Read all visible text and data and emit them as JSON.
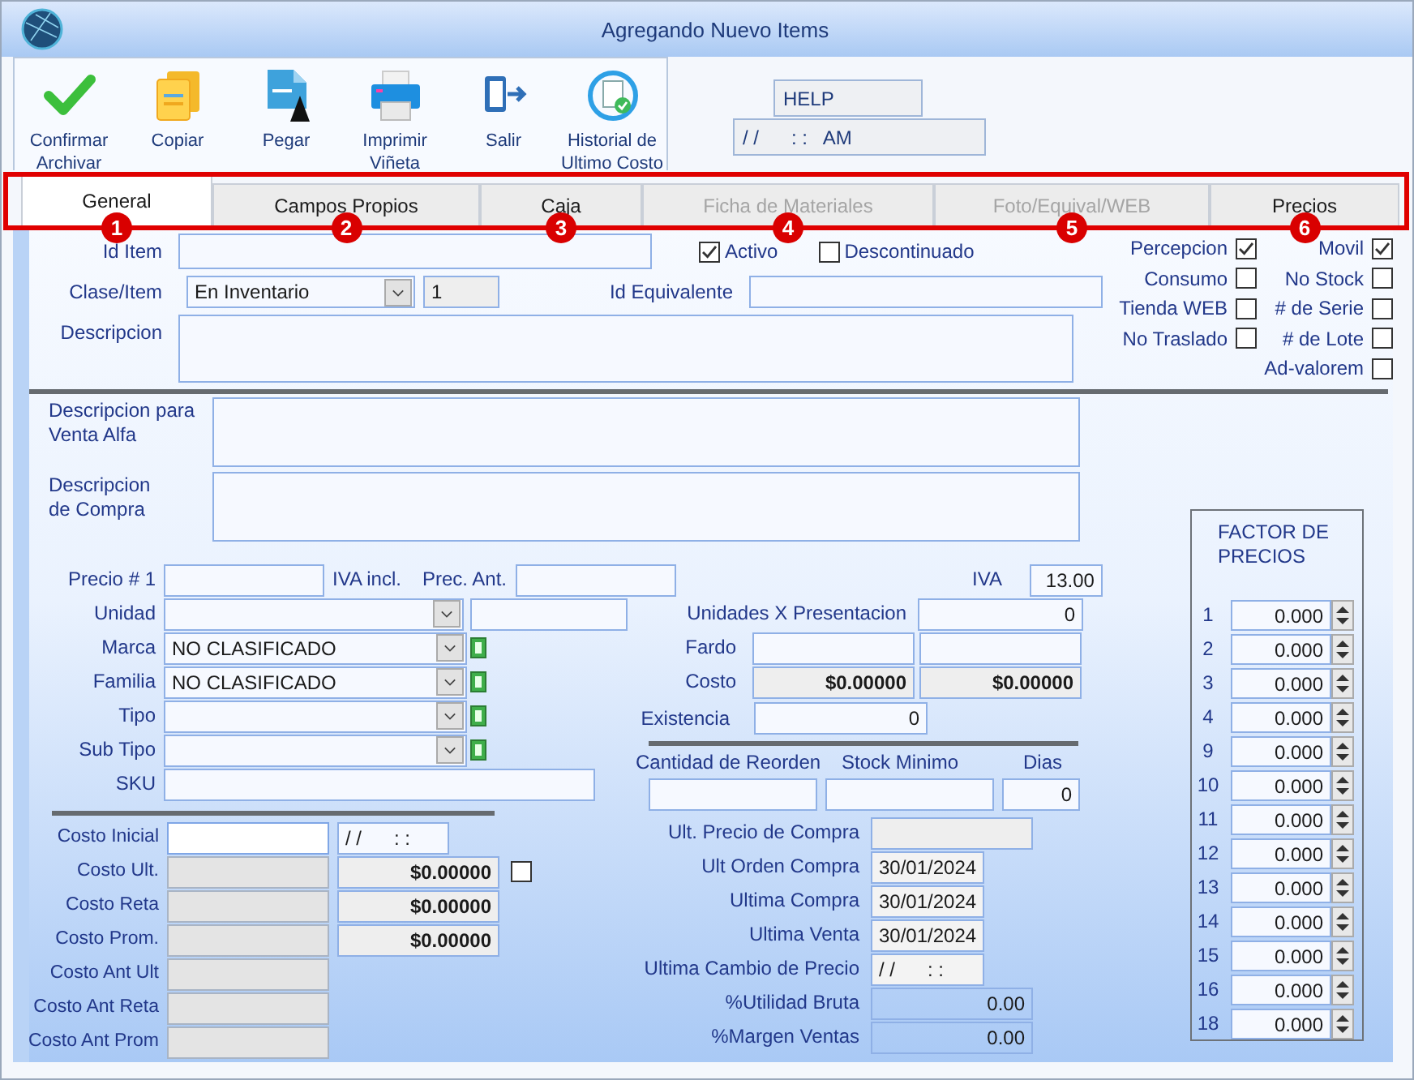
{
  "window": {
    "title": "Agregando Nuevo Items"
  },
  "toolbar": [
    {
      "label": "Confirmar\nArchivar"
    },
    {
      "label": "Copiar"
    },
    {
      "label": "Pegar"
    },
    {
      "label": "Imprimir\nViñeta"
    },
    {
      "label": "Salir"
    },
    {
      "label": "Historial de\nUltimo Costo"
    }
  ],
  "help_field": {
    "value": "HELP"
  },
  "datetime_field": {
    "value": "/ /      : :   AM"
  },
  "tabs": [
    {
      "label": "General",
      "selected": true,
      "disabled": false,
      "marker": "1"
    },
    {
      "label": "Campos Propios",
      "selected": false,
      "disabled": false,
      "marker": "2"
    },
    {
      "label": "Caja",
      "selected": false,
      "disabled": false,
      "marker": "3"
    },
    {
      "label": "Ficha de Materiales",
      "selected": false,
      "disabled": true,
      "marker": "4"
    },
    {
      "label": "Foto/Equival/WEB",
      "selected": false,
      "disabled": true,
      "marker": "5"
    },
    {
      "label": "Precios",
      "selected": false,
      "disabled": false,
      "marker": "6"
    }
  ],
  "item": {
    "id_label": "Id Item",
    "activo": {
      "label": "Activo",
      "checked": true
    },
    "descontinuado": {
      "label": "Descontinuado",
      "checked": false
    },
    "clase_label": "Clase/Item",
    "clase_value": "En Inventario",
    "clase_number": "1",
    "equivalente_label": "Id Equivalente",
    "descripcion_label": "Descripcion"
  },
  "flags_left": [
    {
      "label": "Percepcion",
      "checked": true
    },
    {
      "label": "Consumo",
      "checked": false
    },
    {
      "label": "Tienda WEB",
      "checked": false
    },
    {
      "label": "No Traslado",
      "checked": false
    }
  ],
  "flags_right": [
    {
      "label": "Movil",
      "checked": true
    },
    {
      "label": "No Stock",
      "checked": false
    },
    {
      "label": "# de Serie",
      "checked": false
    },
    {
      "label": "# de Lote",
      "checked": false
    },
    {
      "label": "Ad-valorem",
      "checked": false
    }
  ],
  "descriptions": [
    {
      "label": "Descripcion para\nVenta Alfa"
    },
    {
      "label": "Descripcion\nde Compra"
    }
  ],
  "precio": {
    "label": "Precio # 1",
    "iva_incl": "IVA incl.",
    "prec_ant": "Prec. Ant.",
    "iva_label": "IVA",
    "iva_value": "13.00"
  },
  "classification": [
    {
      "label": "Unidad",
      "kind": "select_extra"
    },
    {
      "label": "Marca",
      "value": "NO CLASIFICADO",
      "kind": "select_add"
    },
    {
      "label": "Familia",
      "value": "NO CLASIFICADO",
      "kind": "select_add"
    },
    {
      "label": "Tipo",
      "kind": "select_add"
    },
    {
      "label": "Sub Tipo",
      "kind": "select_add"
    },
    {
      "label": "SKU",
      "kind": "text"
    }
  ],
  "costs": [
    {
      "label": "Costo Inicial",
      "disabled": false,
      "extra": {
        "kind": "date",
        "value": "/ /      : :"
      }
    },
    {
      "label": "Costo Ult.",
      "disabled": true,
      "extra": {
        "kind": "money",
        "value": "$0.00000"
      },
      "check": {
        "checked": false
      }
    },
    {
      "label": "Costo Reta",
      "disabled": true,
      "extra": {
        "kind": "money",
        "value": "$0.00000"
      }
    },
    {
      "label": "Costo Prom.",
      "disabled": true,
      "extra": {
        "kind": "money",
        "value": "$0.00000"
      }
    },
    {
      "label": "Costo Ant Ult",
      "disabled": true
    },
    {
      "label": "Costo Ant Reta",
      "disabled": true
    },
    {
      "label": "Costo Ant Prom",
      "disabled": true
    }
  ],
  "stock": {
    "unidades_label": "Unidades X Presentacion",
    "unidades_value": "0",
    "fardo_label": "Fardo",
    "costo_label": "Costo",
    "costo_values": [
      "$0.00000",
      "$0.00000"
    ],
    "existencia_label": "Existencia",
    "existencia_value": "0",
    "reorden_label": "Cantidad de Reorden",
    "stock_min_label": "Stock Minimo",
    "dias_label": "Dias",
    "dias_value": "0"
  },
  "history": [
    {
      "label": "Ult. Precio de Compra",
      "kind": "wide"
    },
    {
      "label": "Ult Orden Compra",
      "value": "30/01/2024",
      "kind": "date"
    },
    {
      "label": "Ultima Compra",
      "value": "30/01/2024",
      "kind": "date"
    },
    {
      "label": "Ultima Venta",
      "value": "30/01/2024",
      "kind": "date"
    },
    {
      "label": "Ultima Cambio de Precio",
      "value": "/ /      : :",
      "kind": "date"
    },
    {
      "label": "%Utilidad Bruta",
      "value": "0.00",
      "kind": "result"
    },
    {
      "label": "%Margen Ventas",
      "value": "0.00",
      "kind": "result"
    }
  ],
  "factor": {
    "title": "FACTOR DE\nPRECIOS",
    "rows": [
      {
        "number": "1",
        "value": "0.000"
      },
      {
        "number": "2",
        "value": "0.000"
      },
      {
        "number": "3",
        "value": "0.000"
      },
      {
        "number": "4",
        "value": "0.000"
      },
      {
        "number": "9",
        "value": "0.000"
      },
      {
        "number": "10",
        "value": "0.000"
      },
      {
        "number": "11",
        "value": "0.000"
      },
      {
        "number": "12",
        "value": "0.000"
      },
      {
        "number": "13",
        "value": "0.000"
      },
      {
        "number": "14",
        "value": "0.000"
      },
      {
        "number": "15",
        "value": "0.000"
      },
      {
        "number": "16",
        "value": "0.000"
      },
      {
        "number": "18",
        "value": "0.000"
      }
    ]
  }
}
